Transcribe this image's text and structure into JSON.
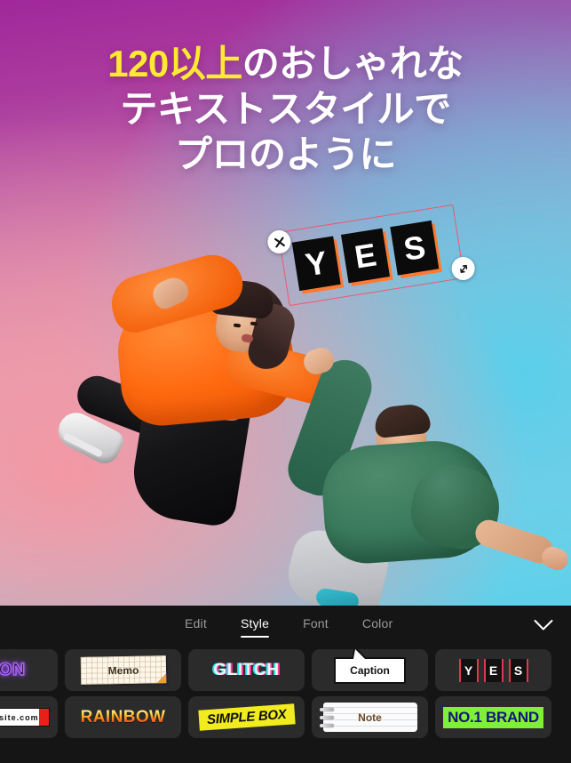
{
  "headline": {
    "line1_accent": "120以上",
    "line1_rest": "のおしゃれな",
    "line2": "テキストスタイルで",
    "line3": "プロのように",
    "accent_color": "#ffe932",
    "text_color": "#ffffff"
  },
  "canvas": {
    "background_colors": [
      "#a0289b",
      "#f496a2",
      "#58d0eb"
    ],
    "selected_object": {
      "letters": [
        "Y",
        "E",
        "S"
      ],
      "frame_color": "#f2576b",
      "letter_bg": "#0b0b0b",
      "letter_color": "#ffffff",
      "shadow_color": "#ff7a2f",
      "close_handle": "close-icon",
      "resize_handle": "resize-icon"
    }
  },
  "toolbar": {
    "tabs": [
      {
        "label": "Edit",
        "active": false
      },
      {
        "label": "Style",
        "active": true
      },
      {
        "label": "Font",
        "active": false
      },
      {
        "label": "Color",
        "active": false
      }
    ],
    "confirm_icon": "checkmark-icon"
  },
  "presets": {
    "row1": [
      {
        "name": "neon",
        "label": "NEON"
      },
      {
        "name": "memo",
        "label": "Memo"
      },
      {
        "name": "glitch",
        "label": "GLITCH"
      },
      {
        "name": "caption",
        "label": "Caption"
      },
      {
        "name": "yes",
        "label": "YES"
      }
    ],
    "row2": [
      {
        "name": "website",
        "label": "www.website.com"
      },
      {
        "name": "rainbow",
        "label": "RAINBOW"
      },
      {
        "name": "simple-box",
        "label": "SIMPLE BOX"
      },
      {
        "name": "note",
        "label": "Note"
      },
      {
        "name": "brand",
        "label": "NO.1 BRAND"
      }
    ]
  }
}
